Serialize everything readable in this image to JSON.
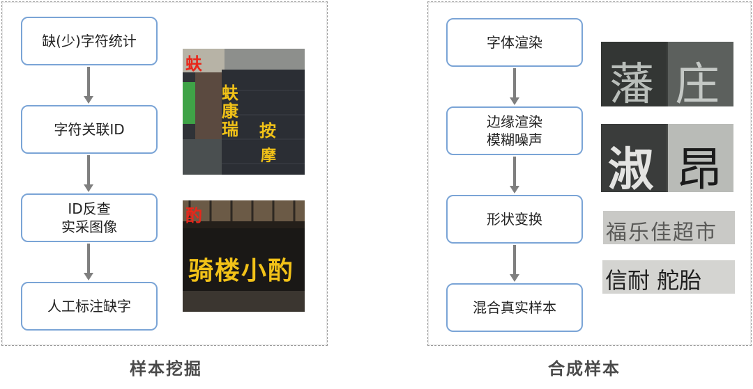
{
  "left": {
    "steps": [
      "缺(少)字符统计",
      "字符关联ID",
      "ID反查\n实采图像",
      "人工标注缺字"
    ],
    "photo1": {
      "label": "蚨",
      "sign": [
        "蚨",
        "康",
        "瑞",
        "按",
        "摩"
      ]
    },
    "photo2": {
      "label": "酌",
      "sign": "骑楼小酌"
    },
    "caption": "样本挖掘"
  },
  "right": {
    "steps": [
      "字体渲染",
      "边缘渲染\n模糊噪声",
      "形状变换",
      "混合真实样本"
    ],
    "samples": [
      {
        "chars": [
          "藩",
          "庄"
        ]
      },
      {
        "chars": [
          "淑",
          "昂"
        ]
      },
      {
        "text": "福乐佳超市"
      },
      {
        "text": "信耐 舵胎"
      }
    ],
    "caption": "合成样本"
  },
  "colors": {
    "box_border": "#7aa4d6",
    "arrow": "#7f7f7f",
    "label_red": "#e8261a",
    "sign_yellow": "#f2c218"
  }
}
